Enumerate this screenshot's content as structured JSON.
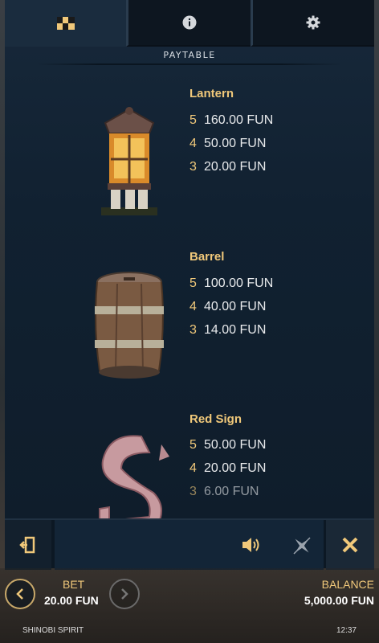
{
  "tabs": [
    {
      "name": "paytable-tab",
      "icon": "checkerboard-icon",
      "active": true
    },
    {
      "name": "info-tab",
      "icon": "info-icon",
      "active": false
    },
    {
      "name": "settings-tab",
      "icon": "gear-icon",
      "active": false
    }
  ],
  "section_title": "PAYTABLE",
  "symbols": [
    {
      "name": "Lantern",
      "icon": "lantern-icon",
      "pays": [
        {
          "count": "5",
          "amount": "160.00 FUN"
        },
        {
          "count": "4",
          "amount": "50.00 FUN"
        },
        {
          "count": "3",
          "amount": "20.00 FUN"
        }
      ]
    },
    {
      "name": "Barrel",
      "icon": "barrel-icon",
      "pays": [
        {
          "count": "5",
          "amount": "100.00 FUN"
        },
        {
          "count": "4",
          "amount": "40.00 FUN"
        },
        {
          "count": "3",
          "amount": "14.00 FUN"
        }
      ]
    },
    {
      "name": "Red Sign",
      "icon": "red-sign-icon",
      "pays": [
        {
          "count": "5",
          "amount": "50.00 FUN"
        },
        {
          "count": "4",
          "amount": "20.00 FUN"
        },
        {
          "count": "3",
          "amount": "6.00 FUN"
        }
      ]
    }
  ],
  "toolbar": {
    "exit_icon": "exit-door-icon",
    "sound_icon": "speaker-icon",
    "turbo_icon": "shuriken-icon",
    "close_icon": "close-icon"
  },
  "footer": {
    "bet_label": "BET",
    "bet_value": "20.00 FUN",
    "balance_label": "BALANCE",
    "balance_value": "5,000.00 FUN",
    "game_name": "SHINOBI SPIRIT",
    "time": "12:37"
  },
  "colors": {
    "accent": "#f0c87a",
    "panel": "#112131"
  }
}
